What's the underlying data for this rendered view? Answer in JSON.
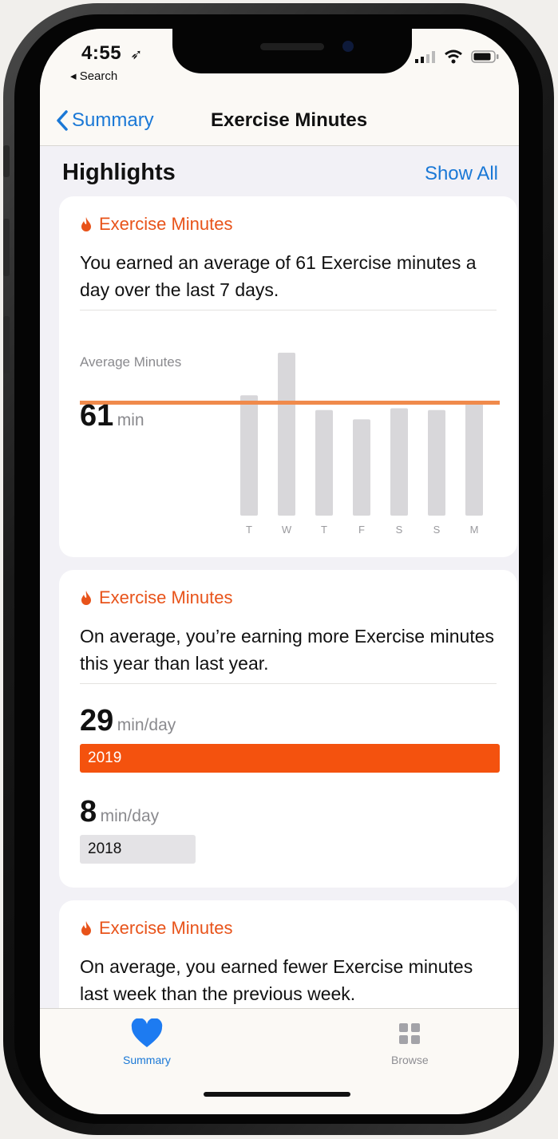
{
  "status": {
    "time": "4:55",
    "back_app": "◂ Search"
  },
  "nav": {
    "back_label": "Summary",
    "title": "Exercise Minutes"
  },
  "highlights": {
    "heading": "Highlights",
    "show_all": "Show All"
  },
  "cards": [
    {
      "category": "Exercise Minutes",
      "text": "You earned an average of 61 Exercise minutes a day over the last 7 days.",
      "average_label": "Average Minutes",
      "average_value": "61",
      "average_unit": "min"
    },
    {
      "category": "Exercise Minutes",
      "text": "On average, you’re earning more Exercise minutes this year than last year.",
      "current_value": "29",
      "current_unit": "min/day",
      "current_year": "2019",
      "previous_value": "8",
      "previous_unit": "min/day",
      "previous_year": "2018"
    },
    {
      "category": "Exercise Minutes",
      "text": "On average, you earned fewer Exercise minutes last week than the previous week."
    }
  ],
  "chart_data": {
    "type": "bar",
    "categories": [
      "T",
      "W",
      "T",
      "F",
      "S",
      "S",
      "M"
    ],
    "values": [
      65,
      88,
      57,
      52,
      58,
      57,
      62
    ],
    "average": 61,
    "ylim": [
      0,
      100
    ],
    "colors": {
      "bar": "#d8d7da",
      "average_line": "#f08a4b"
    }
  },
  "comparison_data": {
    "current_per_day": 29,
    "previous_per_day": 8,
    "unit": "min/day"
  },
  "tabbar": {
    "items": [
      {
        "label": "Summary",
        "icon": "heart-icon",
        "active": true
      },
      {
        "label": "Browse",
        "icon": "grid-icon",
        "active": false
      }
    ]
  },
  "colors": {
    "accent": "#1a78d6",
    "fitness": "#e8531a",
    "bar_2019": "#f4520e",
    "bar_2018": "#e4e3e6"
  }
}
